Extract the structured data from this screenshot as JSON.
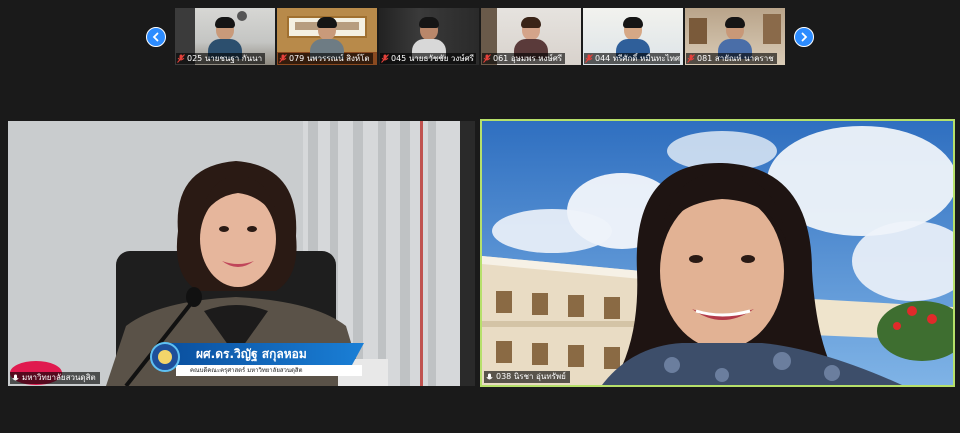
{
  "gallery": {
    "thumbnails": [
      {
        "name": "025 นายชนฐา กันนา",
        "muted": true,
        "scene": "office-wall",
        "shirt": "#2c4f6e"
      },
      {
        "name": "079 นพวรรณน์ สิงห์โต",
        "muted": true,
        "scene": "shrine-sign",
        "shirt": "#6e7c84"
      },
      {
        "name": "045 นายธวัชชัย วงษ์ศรี",
        "muted": true,
        "scene": "dark-curtain",
        "shirt": "#d8d8d8"
      },
      {
        "name": "061 อุษมพร หงษ์ศรี",
        "muted": true,
        "scene": "light-room",
        "shirt": "#5a3a3a"
      },
      {
        "name": "044 ทรีศักดิ์ หมื่นทะไทศ",
        "muted": true,
        "scene": "bright-room",
        "shirt": "#2f5f9a"
      },
      {
        "name": "081 สายัณห์ นาคราช",
        "muted": true,
        "scene": "shelf-room",
        "shirt": "#4a6ea8"
      }
    ],
    "prev_icon": "chevron-left-icon",
    "next_icon": "chevron-right-icon"
  },
  "main": {
    "left": {
      "name": "มหาวิทยาลัยสวนดุสิต",
      "muted": false,
      "banner_title": "ผศ.ดร.วิญัฐ สกุลหอม",
      "banner_subtitle": "คณบดีคณะครุศาสตร์ มหาวิทยาลัยสวนดุสิต"
    },
    "right": {
      "name": "038 นิรชา อุ่นทรัพย์",
      "muted": false,
      "active_speaker": true
    }
  },
  "colors": {
    "background": "#1a1a1a",
    "nav_blue": "#2d8cff",
    "active_border": "#b6e06a",
    "muted_red": "#e5413b",
    "banner_blue": "#0a4f9e"
  }
}
